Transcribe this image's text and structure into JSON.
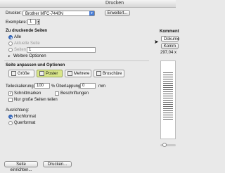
{
  "window": {
    "title": "Drucken"
  },
  "printer": {
    "label": "Drucker:",
    "value": "Brother MFC-7440N",
    "advanced_button": "Erweitert..."
  },
  "copies": {
    "label": "Exemplare:",
    "value": "1"
  },
  "pages_section": {
    "title": "Zu druckende Seiten",
    "all": "Alle",
    "current": "Aktuelle Seite",
    "pages": "Seiten",
    "pages_value": "1",
    "more_options": "Weitere Optionen"
  },
  "comments": {
    "title": "Komment",
    "doc_select": "Dokume",
    "summary_button": "Komm"
  },
  "preview": {
    "size": "297,04 x"
  },
  "fit_section": {
    "title": "Seite anpassen und Optionen",
    "modes": [
      "Größe",
      "Poster",
      "Mehrere",
      "Broschüre"
    ]
  },
  "tiles": {
    "scale_label": "Teileskalierung:",
    "scale_value": "100",
    "scale_unit": "%",
    "overlap_label": "Überlappung:",
    "overlap_value": "0",
    "overlap_unit": "mm",
    "cut_marks": "Schnittmarken",
    "labels": "Beschriftungen",
    "big_only": "Nur große Seiten teilen"
  },
  "orientation": {
    "title": "Ausrichtung:",
    "portrait": "Hochformat",
    "landscape": "Querformat"
  },
  "footer": {
    "page_setup": "Seite einrichten...",
    "print": "Drucken..."
  }
}
